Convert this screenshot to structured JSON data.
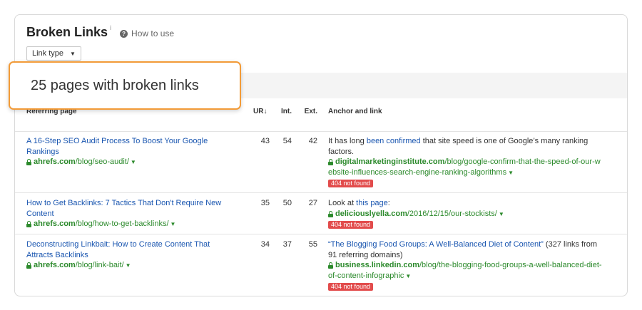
{
  "header": {
    "title": "Broken Links",
    "info_mark": "i",
    "howto_label": "How to use",
    "link_type_label": "Link type"
  },
  "callout": {
    "text": "25 pages with broken links"
  },
  "columns": {
    "referring": "Referring page",
    "ur": "UR",
    "int": "Int.",
    "ext": "Ext.",
    "anchor": "Anchor and link"
  },
  "rows": [
    {
      "title_line1": "A 16-Step SEO Audit Process To Boost Your Google",
      "title_line2": "Rankings",
      "domain": "ahrefs.com",
      "path": "/blog/seo-audit/",
      "ur": "43",
      "int": "54",
      "ext": "42",
      "anchor_pre": "It has long ",
      "anchor_link": "been confirmed",
      "anchor_post": " that site speed is one of Google’s many ranking",
      "anchor_line2": "factors.",
      "target_domain": "digitalmarketinginstitute.com",
      "target_path1": "/blog/google-confirm-that-the-speed-of-our-w",
      "target_path2": "ebsite-influences-search-engine-ranking-algorithms",
      "status": "404 not found"
    },
    {
      "title_line1": "How to Get Backlinks: 7 Tactics That Don't Require New",
      "title_line2": "Content",
      "domain": "ahrefs.com",
      "path": "/blog/how-to-get-backlinks/",
      "ur": "35",
      "int": "50",
      "ext": "27",
      "anchor_pre": "Look at ",
      "anchor_link": "this page",
      "anchor_post": ":",
      "target_domain": "deliciouslyella.com",
      "target_path1": "/2016/12/15/our-stockists/",
      "status": "404 not found"
    },
    {
      "title_line1": "Deconstructing Linkbait: How to Create Content That",
      "title_line2": "Attracts Backlinks",
      "domain": "ahrefs.com",
      "path": "/blog/link-bait/",
      "ur": "34",
      "int": "37",
      "ext": "55",
      "anchor_link": "“The Blogging Food Groups: A Well-Balanced Diet of Content”",
      "anchor_post": " (327 links from",
      "anchor_line2": "91 referring domains)",
      "target_domain": "business.linkedin.com",
      "target_path1": "/blog/the-blogging-food-groups-a-well-balanced-diet-",
      "target_path2": "of-content-infographic",
      "status": "404 not found"
    }
  ]
}
